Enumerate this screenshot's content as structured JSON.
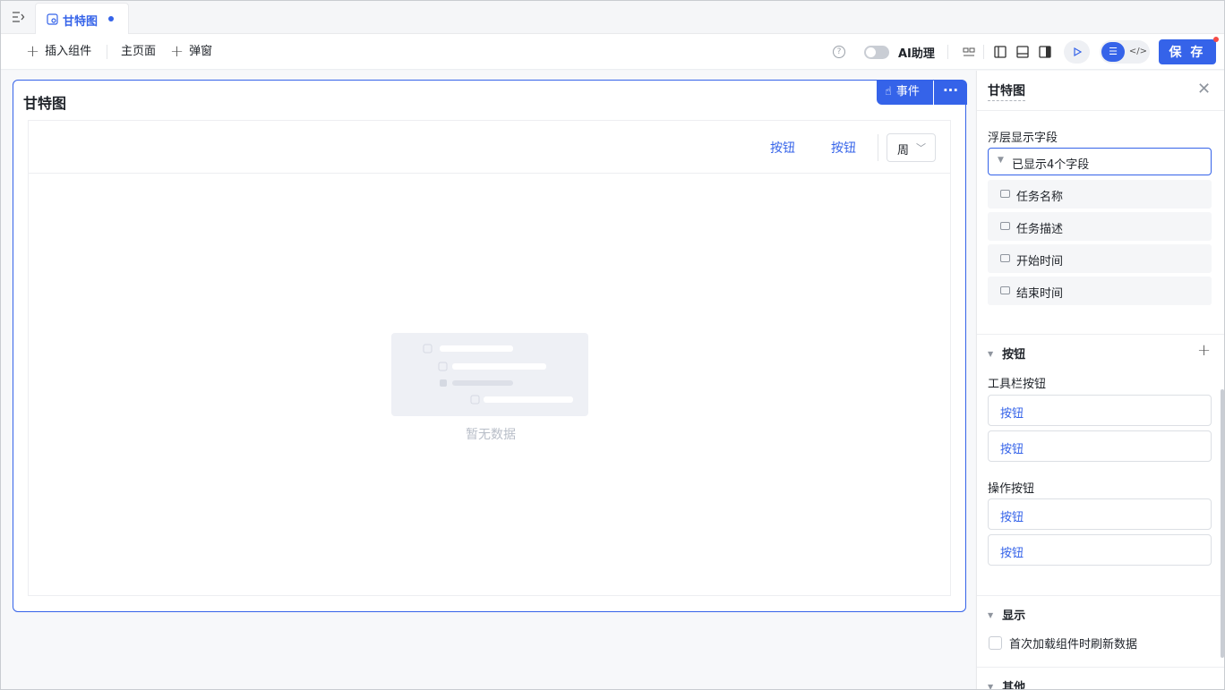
{
  "tab": {
    "title": "甘特图"
  },
  "toolbar": {
    "insert_component": "插入组件",
    "main_page": "主页面",
    "popup": "弹窗",
    "ai_assistant": "AI助理",
    "save": "保 存"
  },
  "card": {
    "title": "甘特图",
    "event_button": "事件",
    "more": "···",
    "buttons": [
      "按钮",
      "按钮"
    ],
    "view_select": "周",
    "empty_text": "暂无数据"
  },
  "panel": {
    "title": "甘特图",
    "hover_fields_label": "浮层显示字段",
    "hover_fields_value": "已显示4个字段",
    "fields": [
      "任务名称",
      "任务描述",
      "开始时间",
      "结束时间"
    ],
    "buttons_section": "按钮",
    "toolbar_buttons_label": "工具栏按钮",
    "toolbar_buttons": [
      "按钮",
      "按钮"
    ],
    "action_buttons_label": "操作按钮",
    "action_buttons": [
      "按钮",
      "按钮"
    ],
    "display_section": "显示",
    "refresh_checkbox": "首次加载组件时刷新数据",
    "other_section": "其他"
  },
  "colors": {
    "accent": "#3563e9",
    "notify": "#f54a45"
  }
}
